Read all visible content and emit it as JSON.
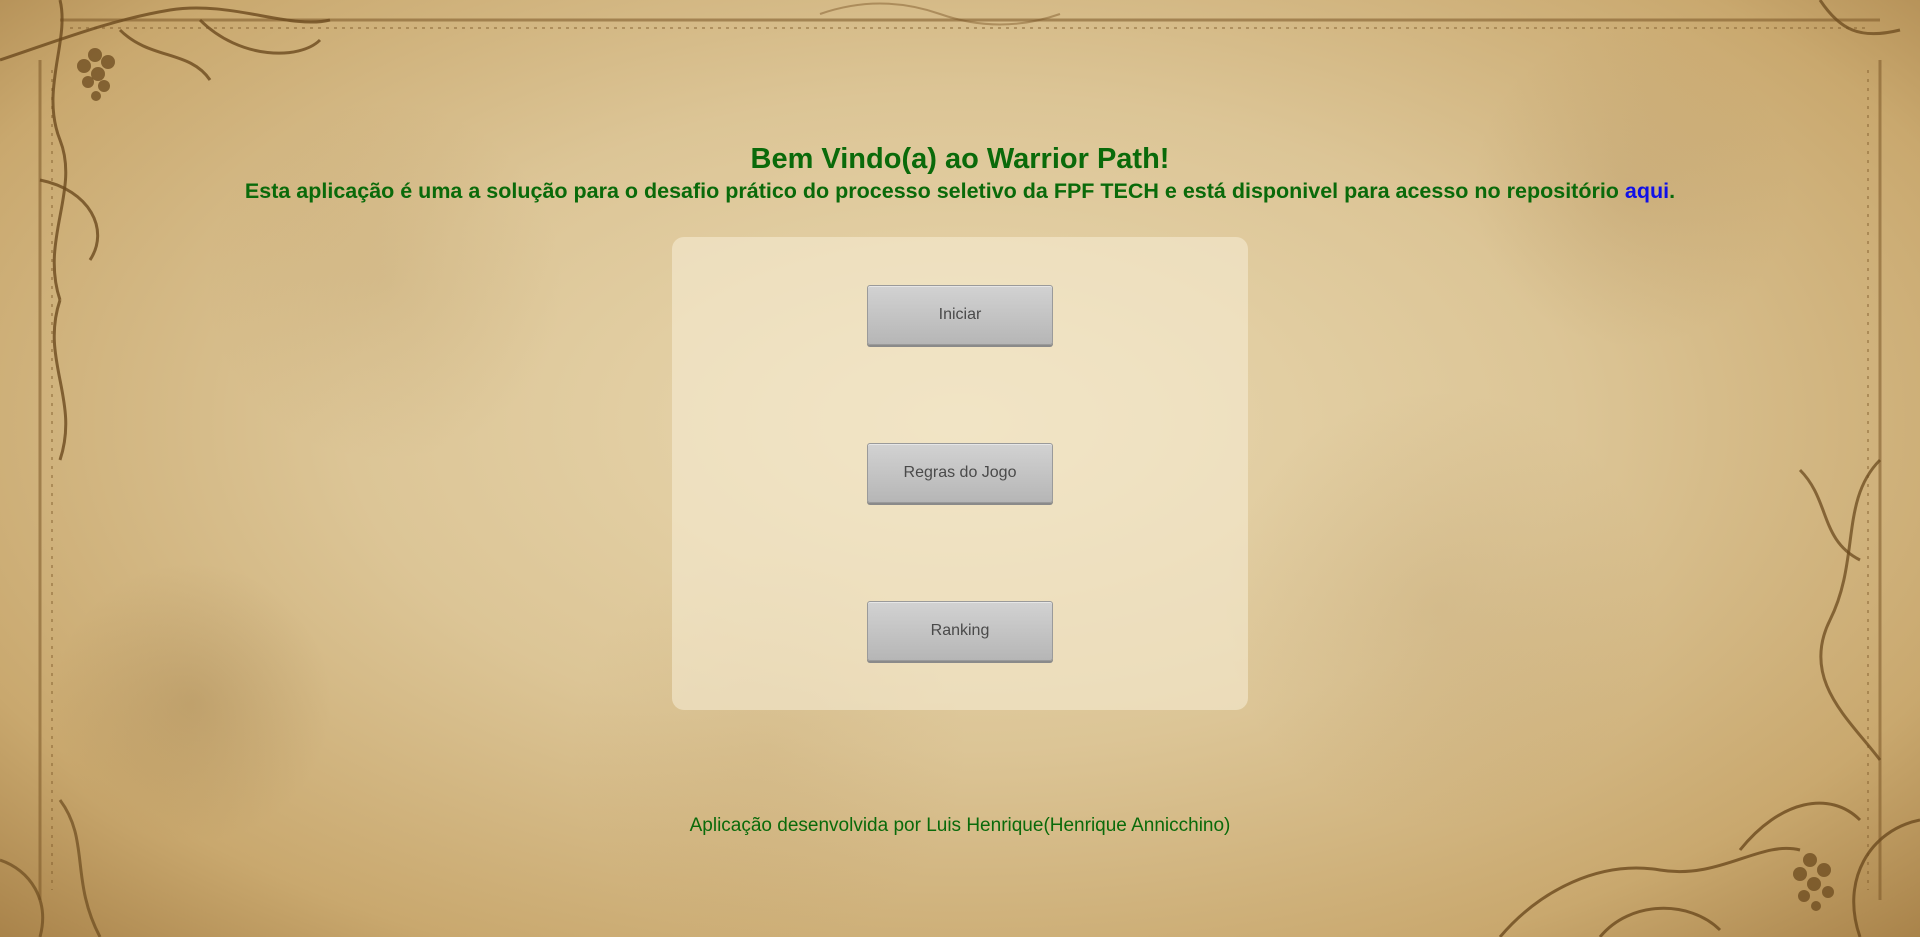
{
  "header": {
    "title": "Bem Vindo(a) ao Warrior Path!",
    "subtitle_text": "Esta aplicação é uma a solução para o desafio prático do processo seletivo da FPF TECH e está disponivel para acesso no repositório ",
    "repo_link_label": "aqui",
    "subtitle_end": "."
  },
  "menu": {
    "start_label": "Iniciar",
    "rules_label": "Regras do Jogo",
    "ranking_label": "Ranking"
  },
  "footer": {
    "credit": "Aplicação desenvolvida por Luis Henrique(Henrique Annicchino)"
  },
  "colors": {
    "heading_green": "#0a6a0a",
    "link_blue": "#1010e8",
    "parchment": "#dcc596",
    "ornament_brown": "#6b4a1e"
  },
  "decor": {
    "frame": "ornamental-vine-frame",
    "corners": [
      "grape-vine-top-left",
      "grape-vine-bottom-right"
    ]
  }
}
